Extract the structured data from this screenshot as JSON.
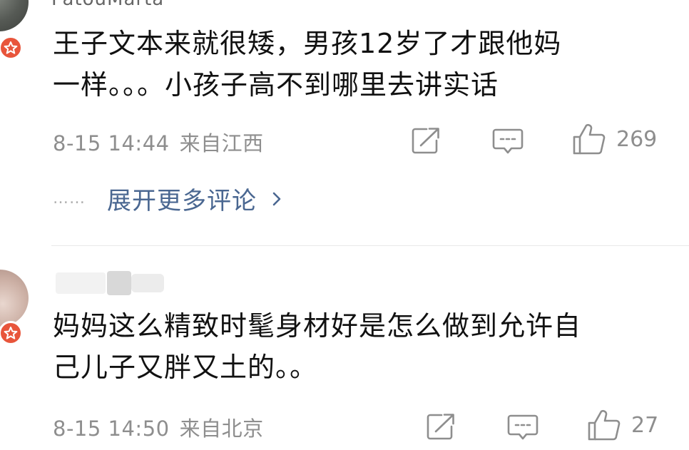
{
  "comments": [
    {
      "username": "PatouMarta",
      "text": "王子文本来就很矮，男孩12岁了才跟他妈\n一样。。。小孩子高不到哪里去讲实话",
      "date": "8-15 14:44",
      "source": "来自江西",
      "like_count": "269"
    },
    {
      "username": "",
      "text": "妈妈这么精致时髦身材好是怎么做到允许自\n己儿子又胖又土的。。",
      "date": "8-15 14:50",
      "source": "来自北京",
      "like_count": "27"
    }
  ],
  "more_replies": {
    "dots": "……",
    "label": "展开更多评论"
  },
  "icons": {
    "share": "share-icon",
    "comment": "comment-icon",
    "like": "thumbs-up-icon",
    "badge": "verified-badge-icon",
    "chevron": "chevron-right-icon"
  },
  "colors": {
    "link": "#4a6791",
    "meta": "#8e8e8e",
    "badge": "#e8553b"
  }
}
